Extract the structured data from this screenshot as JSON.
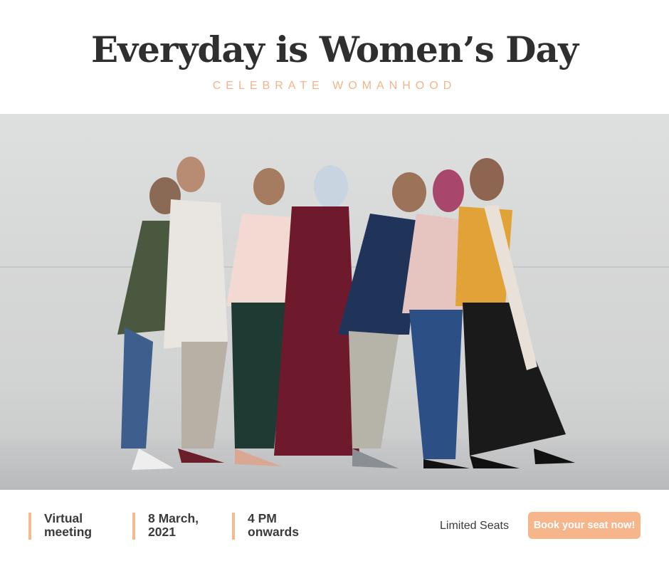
{
  "header": {
    "title": "Everyday is Women’s Day",
    "subtitle": "CELEBRATE WOMANHOOD"
  },
  "footer": {
    "items": [
      {
        "line1": "Virtual",
        "line2": "meeting"
      },
      {
        "line1": "8 March,",
        "line2": "2021"
      },
      {
        "line1": "4 PM",
        "line2": "onwards"
      }
    ],
    "limited": "Limited Seats",
    "button_label": "Book your seat now!"
  },
  "colors": {
    "accent": "#f4b98f",
    "title": "#2f2f2f"
  }
}
